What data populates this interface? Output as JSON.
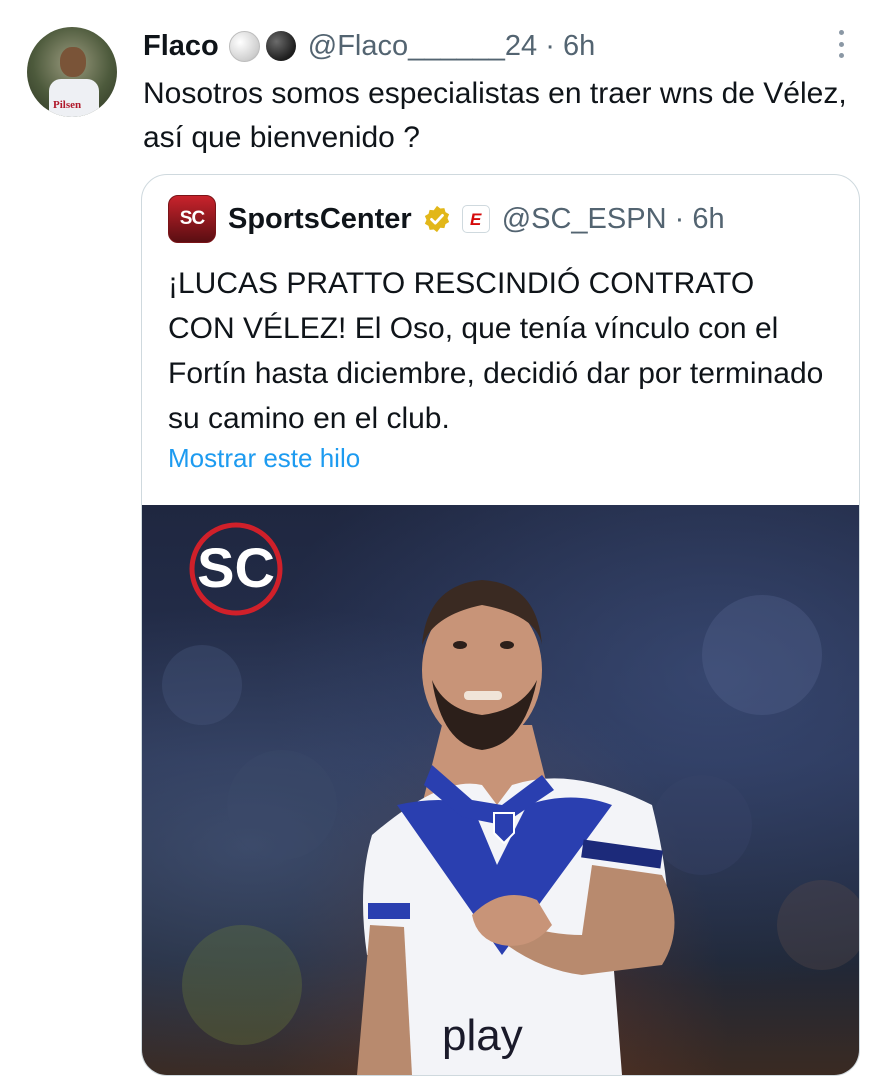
{
  "tweet": {
    "author_name": "Flaco",
    "handle": "@Flaco______24",
    "time": "6h",
    "separator": "·",
    "text": "Nosotros somos especialistas en traer wns de Vélez, así que bienvenido ?",
    "avatar_text": "Pilsen",
    "icons": [
      "white-circle-icon",
      "black-circle-icon",
      "more-options-icon"
    ]
  },
  "quote": {
    "author_name": "SportsCenter",
    "avatar_text": "SC",
    "handle": "@SC_ESPN",
    "time": "6h",
    "separator": "·",
    "badge_text": "E",
    "text": "¡LUCAS PRATTO RESCINDIÓ CONTRATO CON VÉLEZ! El Oso, que tenía vínculo con el Fortín hasta diciembre, decidió dar por terminado su camino en el club.",
    "show_thread": "Mostrar este hilo",
    "icons": [
      "verified-gold-badge-icon",
      "espn-affiliate-icon"
    ]
  },
  "media": {
    "logo_text": "SC",
    "jersey_sponsor": "play"
  },
  "colors": {
    "text": "#0f1419",
    "secondary": "#536471",
    "link": "#1d9bf0",
    "border": "#cfd9de",
    "verified_gold": "#e2b719",
    "sc_red": "#d0202a",
    "jersey_blue": "#2a3fb0"
  }
}
